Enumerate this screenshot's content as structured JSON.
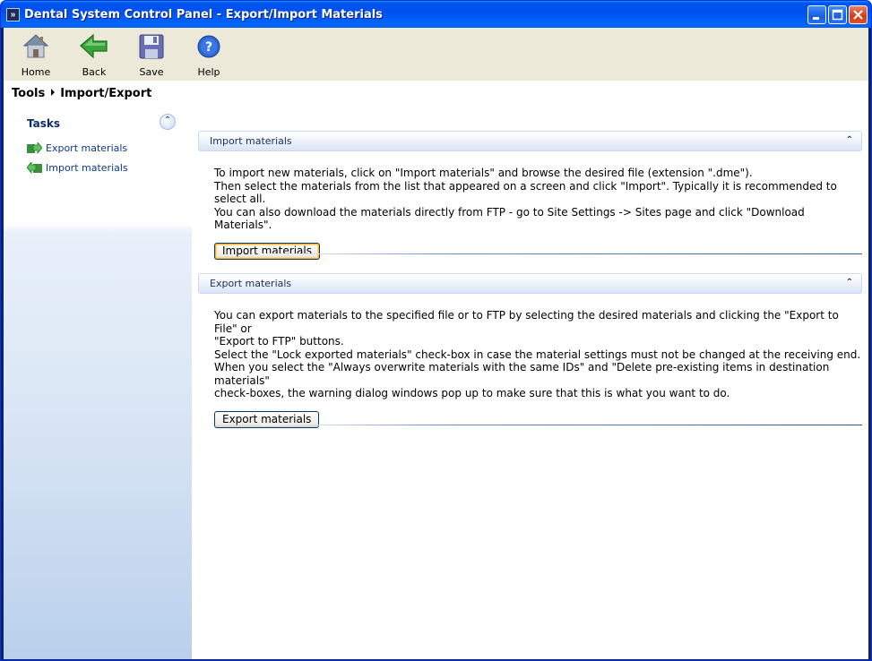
{
  "window": {
    "title": "Dental System Control Panel - Export/Import Materials"
  },
  "toolbar": {
    "home_label": "Home",
    "back_label": "Back",
    "save_label": "Save",
    "help_label": "Help"
  },
  "breadcrumb": {
    "root": "Tools",
    "current": "Import/Export"
  },
  "sidebar": {
    "tasks_header": "Tasks",
    "items": [
      {
        "label": "Export materials",
        "icon": "export-arrow-icon"
      },
      {
        "label": "Import materials",
        "icon": "import-arrow-icon"
      }
    ]
  },
  "import_panel": {
    "title": "Import materials",
    "lines": [
      "To import new materials, click on \"Import materials\" and browse the desired file (extension \".dme\").",
      "Then select the materials from the list that appeared on a screen and click \"Import\". Typically it is recommended to select all.",
      "You can also download the materials directly from FTP - go to Site Settings -> Sites page and click \"Download Materials\"."
    ],
    "button_label": "Import materials"
  },
  "export_panel": {
    "title": "Export materials",
    "lines": [
      "You can export materials to the specified file or to FTP by selecting the desired materials and clicking the \"Export to File\" or",
      "\"Export to FTP\" buttons.",
      "Select the \"Lock exported materials\" check-box in case the material settings must not be changed at the receiving end.",
      "When you select the \"Always overwrite materials with the same IDs\" and \"Delete pre-existing items in destination materials\"",
      "check-boxes, the warning dialog windows pop up to make sure that this is what you want to do."
    ],
    "button_label": "Export materials"
  },
  "colors": {
    "titlebar": "#0053ee",
    "toolbar_bg": "#ece9d8",
    "link": "#0b3a8a",
    "panel_header_text": "#1b2d5b",
    "focus_ring": "#f8b330"
  }
}
